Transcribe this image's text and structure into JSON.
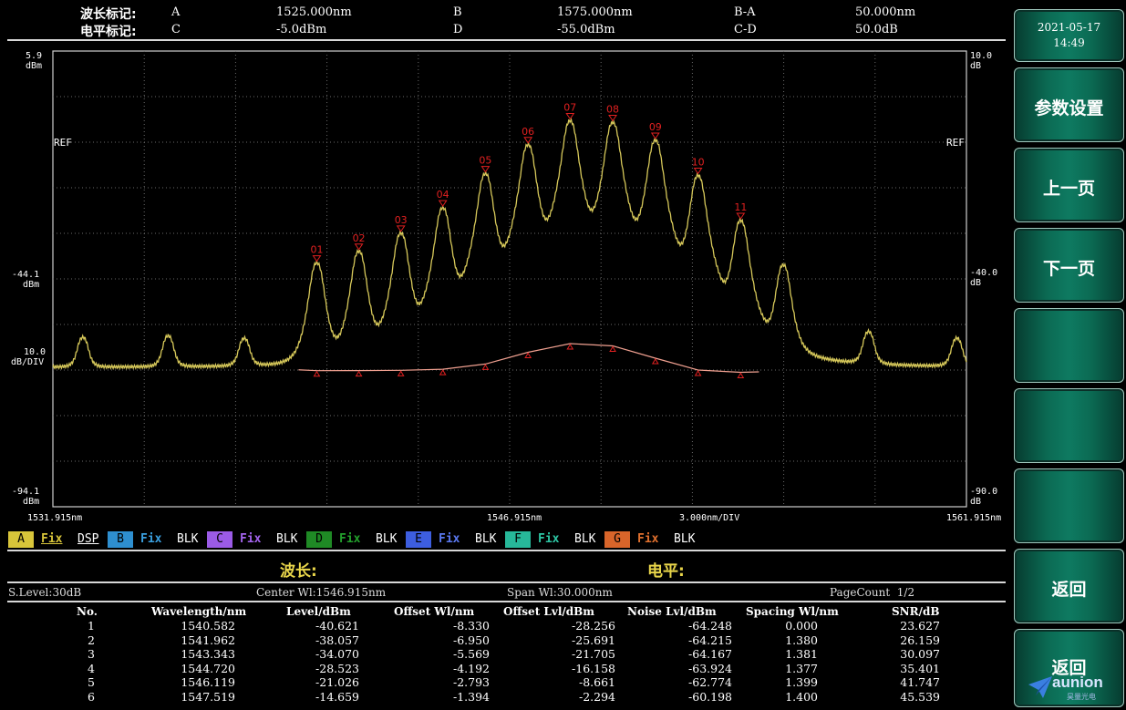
{
  "markers": {
    "wavelength_label": "波长标记:",
    "level_label": "电平标记:",
    "A_name": "A",
    "A_value": "1525.000nm",
    "B_name": "B",
    "B_value": "1575.000nm",
    "BA_name": "B-A",
    "BA_value": "50.000nm",
    "C_name": "C",
    "C_value": "-5.0dBm",
    "D_name": "D",
    "D_value": "-55.0dBm",
    "CD_name": "C-D",
    "CD_value": "50.0dB"
  },
  "plot": {
    "left_top": "5.9",
    "left_top_unit": "dBm",
    "left_mid": "-44.1",
    "left_mid_unit": "dBm",
    "left_scale": "10.0",
    "left_scale_unit": "dB/DIV",
    "left_bot": "-94.1",
    "left_bot_unit": "dBm",
    "right_top": "10.0",
    "right_top_unit": "dB",
    "right_mid": "-40.0",
    "right_mid_unit": "dB",
    "right_bot": "-90.0",
    "right_bot_unit": "dB",
    "ref_left": "REF",
    "ref_right": "REF",
    "x_start": "1531.915nm",
    "x_center": "1546.915nm",
    "x_div": "3.000nm/DIV",
    "x_end": "1561.915nm",
    "peak_labels": [
      "01",
      "02",
      "03",
      "04",
      "05",
      "06",
      "07",
      "08",
      "09",
      "10",
      "11"
    ],
    "trace_color": "#d6c85a",
    "noise_color": "#f0a090",
    "marker_color": "#e02020"
  },
  "chart_data": {
    "type": "line",
    "xlabel": "",
    "ylabel": "",
    "xlim": [
      1531.915,
      1561.915
    ],
    "ylim": [
      -94.1,
      5.9
    ],
    "peaks_x": [
      1532.9,
      1535.7,
      1538.2,
      1540.582,
      1541.962,
      1543.343,
      1544.72,
      1546.119,
      1547.519,
      1548.9,
      1550.3,
      1551.7,
      1553.1,
      1554.5,
      1555.9,
      1558.7,
      1561.6
    ],
    "peaks_level": [
      -58.0,
      -57.6,
      -58.4,
      -40.621,
      -38.057,
      -34.07,
      -28.523,
      -21.026,
      -14.659,
      -9.4,
      -9.8,
      -13.7,
      -21.4,
      -31.3,
      -41.1,
      -56.6,
      -58.3
    ],
    "labeled_peaks_x": [
      1540.582,
      1541.962,
      1543.343,
      1544.72,
      1546.119,
      1547.519,
      1548.9,
      1550.3,
      1551.7,
      1553.1,
      1554.5
    ],
    "labeled_peaks_level": [
      -40.621,
      -38.057,
      -34.07,
      -28.523,
      -21.026,
      -14.659,
      -9.4,
      -9.8,
      -13.7,
      -21.4,
      -31.3
    ],
    "noise_x": [
      1540.582,
      1541.962,
      1543.343,
      1544.72,
      1546.119,
      1547.519,
      1548.9,
      1550.3,
      1551.7,
      1553.1,
      1554.5
    ],
    "noise_level": [
      -64.248,
      -64.215,
      -64.167,
      -63.924,
      -62.774,
      -60.198,
      -58.3,
      -58.8,
      -61.5,
      -64.1,
      -64.6
    ],
    "baseline_level": -63.5
  },
  "traces": [
    {
      "id": "A",
      "color": "#d8c53a",
      "fix": "Fix",
      "mode": "DSP",
      "fix_color": "#d8c53a"
    },
    {
      "id": "B",
      "color": "#2e8fd0",
      "fix": "Fix",
      "mode": "BLK",
      "fix_color": "#3aa0e0"
    },
    {
      "id": "C",
      "color": "#9b5be6",
      "fix": "Fix",
      "mode": "BLK",
      "fix_color": "#a464ee"
    },
    {
      "id": "D",
      "color": "#1f8a25",
      "fix": "Fix",
      "mode": "BLK",
      "fix_color": "#23a02c"
    },
    {
      "id": "E",
      "color": "#3d5ee0",
      "fix": "Fix",
      "mode": "BLK",
      "fix_color": "#5a78f0"
    },
    {
      "id": "F",
      "color": "#27b89a",
      "fix": "Fix",
      "mode": "BLK",
      "fix_color": "#2dc6a4"
    },
    {
      "id": "G",
      "color": "#d9652a",
      "fix": "Fix",
      "mode": "BLK",
      "fix_color": "#e0702e"
    }
  ],
  "readout": {
    "wavelength_label": "波长:",
    "level_label": "电平:",
    "label_color": "#e8d54a"
  },
  "info": {
    "slevel": "S.Level:30dB",
    "center": "Center Wl:1546.915nm",
    "span": "Span Wl:30.000nm",
    "pagecount": "PageCount  1/2"
  },
  "table": {
    "headers": [
      "No.",
      "Wavelength/nm",
      "Level/dBm",
      "Offset Wl/nm",
      "Offset Lvl/dBm",
      "Noise Lvl/dBm",
      "Spacing Wl/nm",
      "SNR/dB"
    ],
    "rows": [
      [
        "1",
        "1540.582",
        "-40.621",
        "-8.330",
        "-28.256",
        "-64.248",
        "0.000",
        "23.627"
      ],
      [
        "2",
        "1541.962",
        "-38.057",
        "-6.950",
        "-25.691",
        "-64.215",
        "1.380",
        "26.159"
      ],
      [
        "3",
        "1543.343",
        "-34.070",
        "-5.569",
        "-21.705",
        "-64.167",
        "1.381",
        "30.097"
      ],
      [
        "4",
        "1544.720",
        "-28.523",
        "-4.192",
        "-16.158",
        "-63.924",
        "1.377",
        "35.401"
      ],
      [
        "5",
        "1546.119",
        "-21.026",
        "-2.793",
        "-8.661",
        "-62.774",
        "1.399",
        "41.747"
      ],
      [
        "6",
        "1547.519",
        "-14.659",
        "-1.394",
        "-2.294",
        "-60.198",
        "1.400",
        "45.539"
      ]
    ]
  },
  "sidebar": {
    "date": "2021-05-17",
    "time": "14:49",
    "buttons": [
      "参数设置",
      "上一页",
      "下一页",
      "",
      "",
      "",
      "返回"
    ],
    "logo_text": "aunion",
    "logo_sub": "昊量光电"
  }
}
